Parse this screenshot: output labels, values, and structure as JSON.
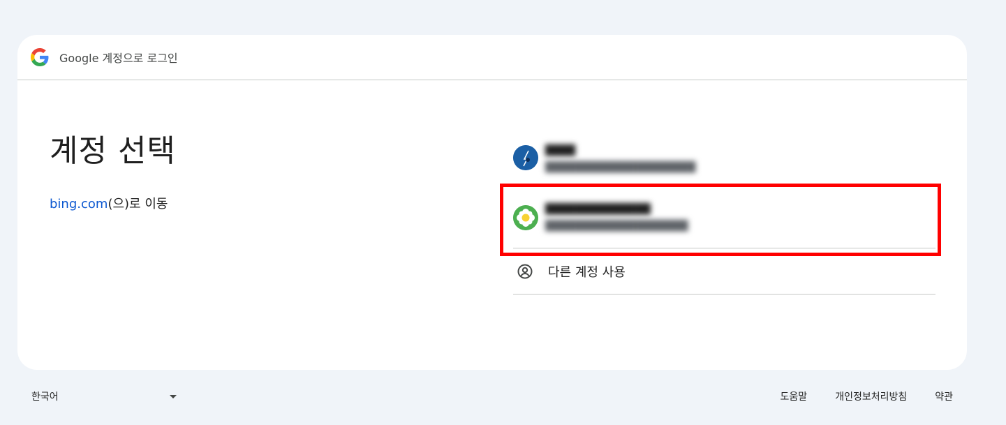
{
  "header": {
    "brand": "Google",
    "text": "계정으로 로그인"
  },
  "main": {
    "title": "계정 선택",
    "destination_link": "bing.com",
    "destination_suffix": "(으)로 이동"
  },
  "accounts": [
    {
      "name": "",
      "email": "",
      "avatar": "blue-avatar"
    },
    {
      "name": "",
      "email": "",
      "avatar": "flower-avatar"
    }
  ],
  "other_account": {
    "label": "다른 계정 사용",
    "icon": "account-circle-icon"
  },
  "footer": {
    "language": "한국어",
    "links": [
      "도움말",
      "개인정보처리방침",
      "약관"
    ]
  },
  "colors": {
    "link": "#0b57d0",
    "highlight": "#ff0000",
    "background": "#f0f4f9"
  }
}
